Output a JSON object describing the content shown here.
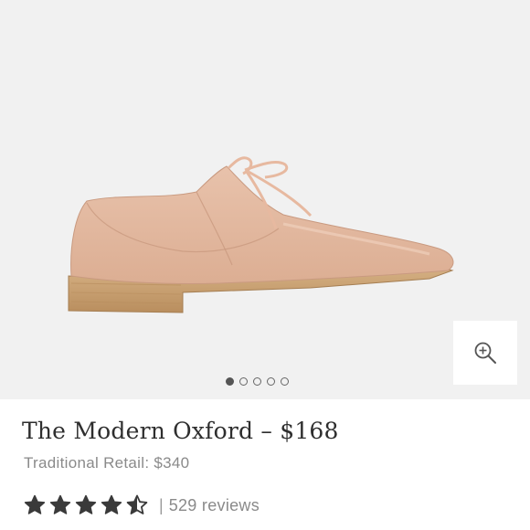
{
  "product": {
    "title": "The Modern Oxford – $168",
    "traditional_retail": "Traditional Retail: $340",
    "rating": 4.5,
    "rating_max": 5,
    "review_separator": "|",
    "reviews_label": "529 reviews"
  },
  "gallery": {
    "image_icon": "oxford-shoe-photo",
    "zoom_icon": "zoom-in-icon",
    "dot_count": 5,
    "active_index": 0
  },
  "colors": {
    "background": "#f1f1f1",
    "shoe_leather": "#e3b9a0",
    "sole": "#c9a173",
    "star": "#3a3a3a",
    "title_text": "#2e2e2e",
    "muted_text": "#8a8a8a"
  }
}
